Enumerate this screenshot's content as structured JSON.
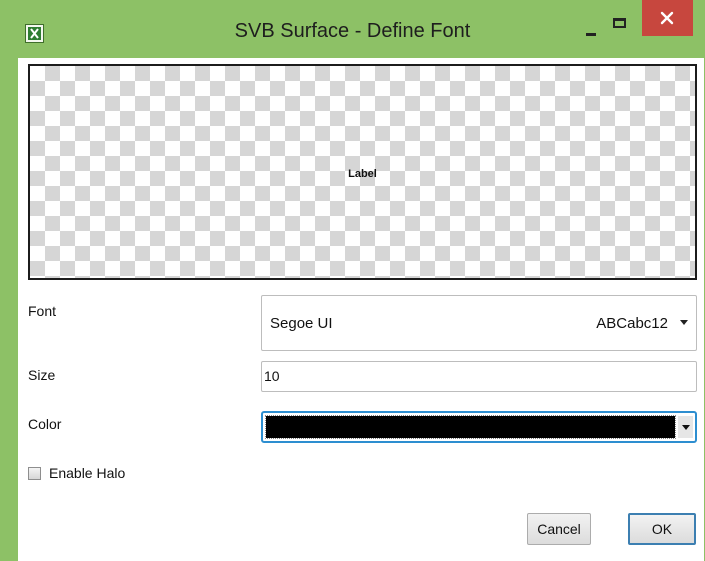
{
  "window": {
    "title": "SVB Surface - Define Font",
    "app_icon": "excel-icon",
    "controls": {
      "minimize": "minimize-icon",
      "maximize": "maximize-icon",
      "close": "close-icon"
    },
    "accent_color": "#8dc166",
    "close_color": "#c7473e"
  },
  "preview": {
    "label": "Label",
    "background": "checkerboard"
  },
  "form": {
    "font_label": "Font",
    "font_value": "Segoe UI",
    "font_sample": "ABCabc12",
    "size_label": "Size",
    "size_value": "10",
    "color_label": "Color",
    "color_value": "#000000",
    "halo_label": "Enable Halo",
    "halo_checked": false
  },
  "buttons": {
    "cancel": "Cancel",
    "ok": "OK"
  }
}
